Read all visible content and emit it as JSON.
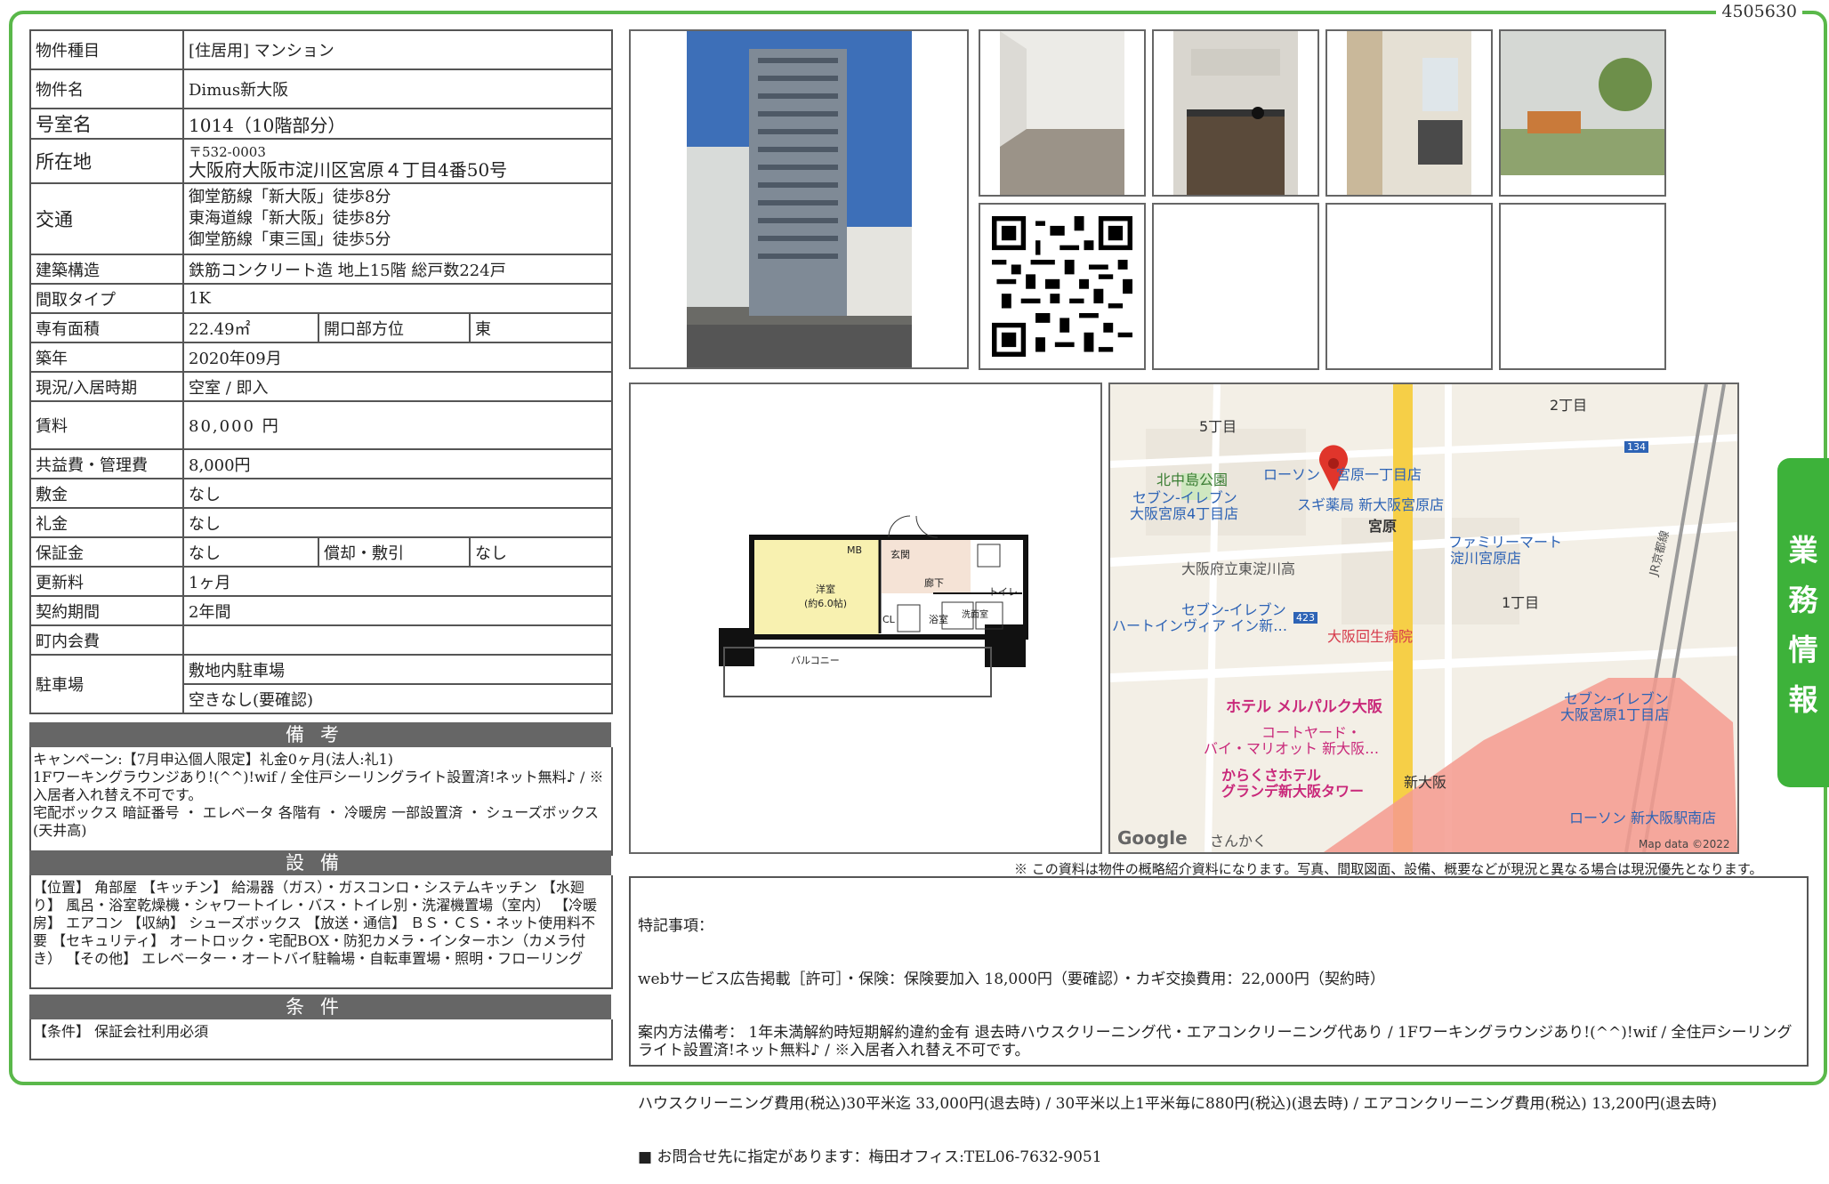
{
  "doc_id": "4505630",
  "side_tab": [
    "業",
    "務",
    "情",
    "報"
  ],
  "info": {
    "type_label": "物件種目",
    "type_value": "[住居用] マンション",
    "name_label": "物件名",
    "name_value": "Dimus新大阪",
    "room_label": "号室名",
    "room_value": "1014（10階部分）",
    "address_label": "所在地",
    "postal": "〒532-0003",
    "address_value": "大阪府大阪市淀川区宮原４丁目4番50号",
    "access_label": "交通",
    "access_lines": [
      "御堂筋線「新大阪」徒歩8分",
      "東海道線「新大阪」徒歩8分",
      "御堂筋線「東三国」徒歩5分"
    ],
    "structure_label": "建築構造",
    "structure_value": "鉄筋コンクリート造 地上15階 総戸数224戸",
    "layout_label": "間取タイプ",
    "layout_value": "1K",
    "area_label": "専有面積",
    "area_value": "22.49㎡",
    "direction_label": "開口部方位",
    "direction_value": "東",
    "built_label": "築年",
    "built_value": "2020年09月",
    "status_label": "現況/入居時期",
    "status_value": "空室 / 即入",
    "rent_label": "賃料",
    "rent_value": "80,000 円",
    "fee_label": "共益費・管理費",
    "fee_value": "8,000円",
    "deposit_label": "敷金",
    "deposit_value": "なし",
    "keymoney_label": "礼金",
    "keymoney_value": "なし",
    "guarantee_label": "保証金",
    "guarantee_value": "なし",
    "amort_label": "償却・敷引",
    "amort_value": "なし",
    "renew_label": "更新料",
    "renew_value": "1ヶ月",
    "contract_label": "契約期間",
    "contract_value": "2年間",
    "community_label": "町内会費",
    "community_value": "",
    "parking_label": "駐車場",
    "parking_value1": "敷地内駐車場",
    "parking_value2": "空きなし(要確認)"
  },
  "remarks_head": "備考",
  "remarks_body": "キャンペーン:【7月申込個人限定】礼金0ヶ月(法人:礼1)\n1Fワーキングラウンジあり!(^^)!wif / 全住戸シーリングライト設置済!ネット無料♪ / ※入居者入れ替え不可です。\n宅配ボックス 暗証番号 ・ エレベータ 各階有 ・ 冷暖房 一部設置済 ・ シューズボックス(天井高)",
  "equipment_head": "設備",
  "equipment_body": "【位置】 角部屋 【キッチン】 給湯器（ガス）・ガスコンロ・システムキッチン 【水廻り】 風呂・浴室乾燥機・シャワートイレ・バス・トイレ別・洗濯機置場（室内） 【冷暖房】 エアコン 【収納】 シューズボックス 【放送・通信】 ＢＳ・ＣＳ・ネット使用料不要 【セキュリティ】 オートロック・宅配BOX・防犯カメラ・インターホン（カメラ付き） 【その他】 エレベーター・オートバイ駐輪場・自転車置場・照明・フローリング",
  "conditions_head": "条件",
  "conditions_body": "【条件】 保証会社利用必須",
  "floorplan": {
    "room_name": "洋室",
    "room_size": "(約6.0帖)",
    "mb": "MB",
    "entrance": "玄関",
    "hall": "廊下",
    "toilet": "トイレ",
    "bath": "浴室",
    "washroom": "洗面室",
    "closet": "CL",
    "balcony": "バルコニー"
  },
  "map": {
    "labels": [
      "5丁目",
      "2丁目",
      "北中島公園",
      "ローソン",
      "宮原一丁目店",
      "セブン-イレブン",
      "大阪宮原4丁目店",
      "スギ薬局 新大阪宮原店",
      "宮原",
      "ファミリーマート",
      "淀川宮原店",
      "大阪府立東淀川高",
      "セブン-イレブン",
      "ハートインヴィア イン新…",
      "1丁目",
      "大阪回生病院",
      "ホテル メルパルク大阪",
      "セブン-イレブン",
      "大阪宮原1丁目店",
      "コートヤード・",
      "バイ・マリオット 新大阪…",
      "からくさホテル",
      "グランデ新大阪タワー",
      "新大阪",
      "ローソン 新大阪駅南店",
      "さんかく",
      "Map data ©2022",
      "JR京都線",
      "134",
      "423"
    ],
    "google": "Google"
  },
  "disclaimer": "※ この資料は物件の概略紹介資料になります。写真、間取図面、設備、概要などが現況と異なる場合は現況優先となります。",
  "special_title": "特記事項：",
  "special_lines": [
    "webサービス広告掲載［許可］・保険：保険要加入 18,000円（要確認）・カギ交換費用：22,000円（契約時）",
    "案内方法備考： 1年未満解約時短期解約違約金有 退去時ハウスクリーニング代・エアコンクリーニング代あり / 1Fワーキングラウンジあり!(^^)!wif / 全住戸シーリングライト設置済!ネット無料♪ / ※入居者入れ替え不可です。",
    "ハウスクリーニング費用(税込)30平米迄 33,000円(退去時) / 30平米以上1平米毎に880円(税込)(退去時) / エアコンクリーニング費用(税込) 13,200円(退去時)",
    "■ お問合せ先に指定があります：梅田オフィス:TEL06-7632-9051"
  ]
}
